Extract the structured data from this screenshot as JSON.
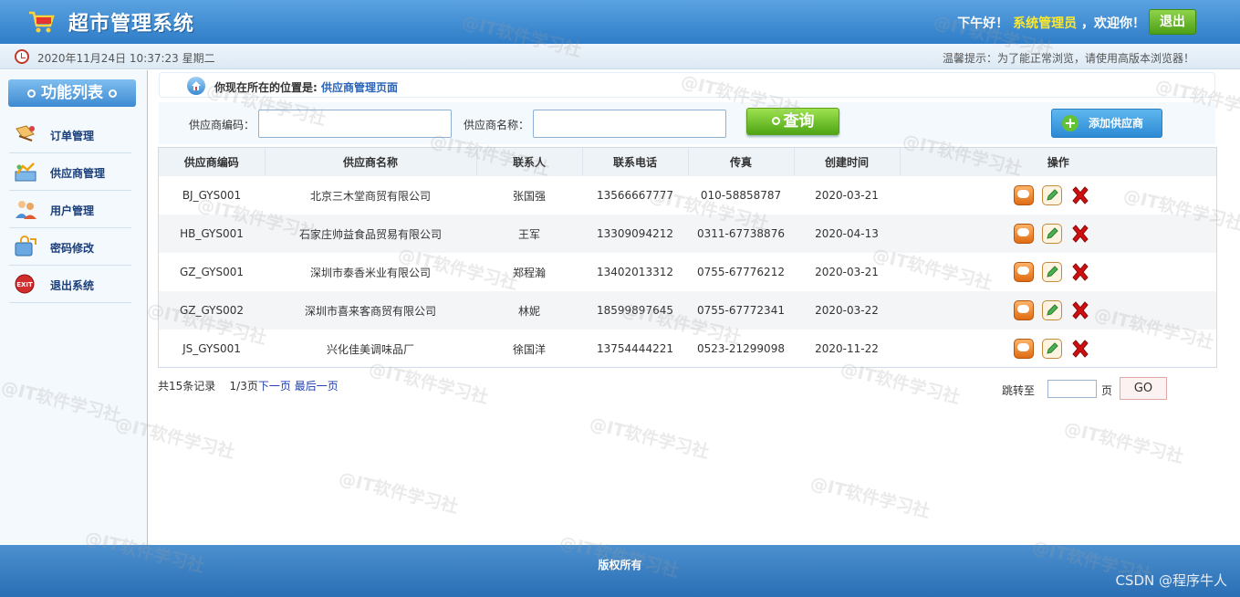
{
  "header": {
    "app_title": "超市管理系统",
    "greeting": "下午好！",
    "user_name": "系统管理员",
    "welcome": "，欢迎你！",
    "logout_label": "退出"
  },
  "infobar": {
    "datetime": "2020年11月24日 10:37:23 星期二",
    "tip": "温馨提示：为了能正常浏览，请使用高版本浏览器！"
  },
  "sidebar": {
    "title": "功能列表",
    "items": [
      {
        "label": "订单管理",
        "icon": "order-icon"
      },
      {
        "label": "供应商管理",
        "icon": "supplier-icon"
      },
      {
        "label": "用户管理",
        "icon": "users-icon"
      },
      {
        "label": "密码修改",
        "icon": "password-icon"
      },
      {
        "label": "退出系统",
        "icon": "exit-icon"
      }
    ]
  },
  "breadcrumb": {
    "prefix": "你现在所在的位置是:",
    "location": "供应商管理页面"
  },
  "search": {
    "code_label": "供应商编码：",
    "code_value": "",
    "name_label": "供应商名称：",
    "name_value": "",
    "query_label": "查询",
    "add_label": "添加供应商"
  },
  "table": {
    "headers": [
      "供应商编码",
      "供应商名称",
      "联系人",
      "联系电话",
      "传真",
      "创建时间",
      "操作"
    ],
    "rows": [
      [
        "BJ_GYS001",
        "北京三木堂商贸有限公司",
        "张国强",
        "13566667777",
        "010-58858787",
        "2020-03-21"
      ],
      [
        "HB_GYS001",
        "石家庄帅益食品贸易有限公司",
        "王军",
        "13309094212",
        "0311-67738876",
        "2020-04-13"
      ],
      [
        "GZ_GYS001",
        "深圳市泰香米业有限公司",
        "郑程瀚",
        "13402013312",
        "0755-67776212",
        "2020-03-21"
      ],
      [
        "GZ_GYS002",
        "深圳市喜来客商贸有限公司",
        "林妮",
        "18599897645",
        "0755-67772341",
        "2020-03-22"
      ],
      [
        "JS_GYS001",
        "兴化佳美调味品厂",
        "徐国洋",
        "13754444221",
        "0523-21299098",
        "2020-11-22"
      ]
    ]
  },
  "pager": {
    "total": "共15条记录",
    "page": "1/3页",
    "next": "下一页",
    "last": "最后一页",
    "jump_label": "跳转至",
    "jump_value": "",
    "jump_unit": "页",
    "go_label": "GO"
  },
  "footer": {
    "copyright": "版权所有",
    "credit": "CSDN @程序牛人"
  },
  "watermark": "@IT软件学习社",
  "colors": {
    "header_blue": "#2f7dc8",
    "green": "#4ea515",
    "delete_red": "#d01010",
    "link_blue": "#1f3fae"
  }
}
